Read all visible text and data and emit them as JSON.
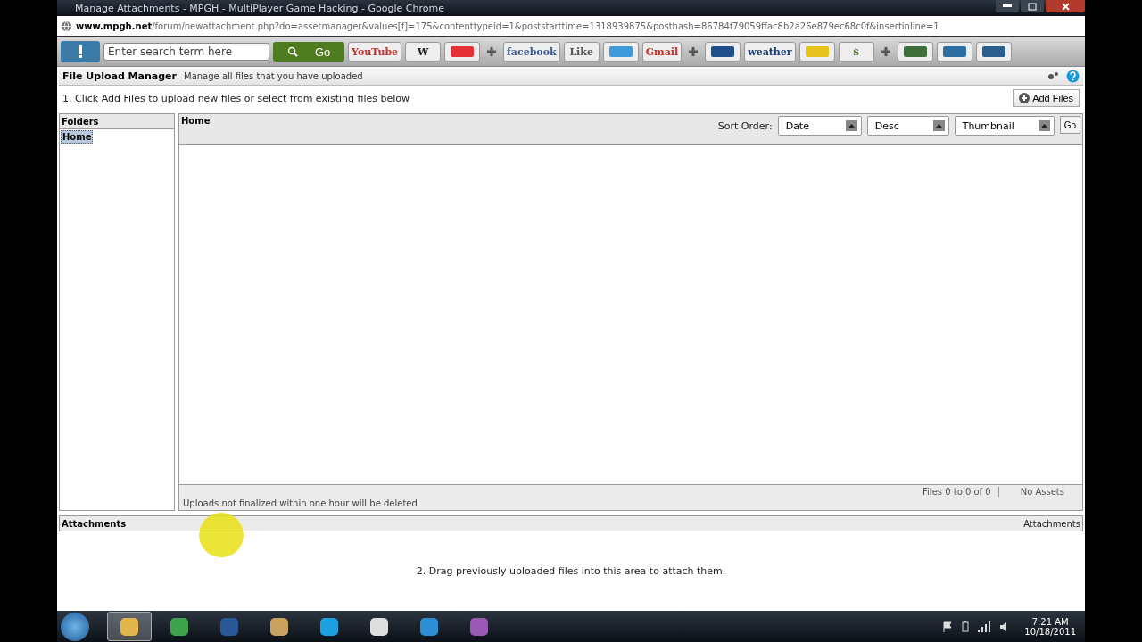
{
  "window": {
    "title": "Manage Attachments - MPGH - MultiPlayer Game Hacking - Google Chrome"
  },
  "address_bar": {
    "host": "www.mpgh.net",
    "path": "/forum/newattachment.php?do=assetmanager&values[f]=175&contenttypeid=1&poststarttime=1318939875&posthash=86784f79059ffac8b2a26e879ec68c0f&insertinline=1"
  },
  "toolbar": {
    "search": {
      "placeholder": "Enter search term here"
    },
    "go_button": "Go",
    "buttons": [
      {
        "kind": "text",
        "label": "YouTube",
        "color": "#c4302b"
      },
      {
        "kind": "text",
        "label": "W",
        "color": "#222222"
      },
      {
        "kind": "icon",
        "color": "#e53238"
      },
      {
        "kind": "plus"
      },
      {
        "kind": "text",
        "label": "facebook",
        "color": "#3b5998"
      },
      {
        "kind": "text",
        "label": "Like",
        "color": "#555555"
      },
      {
        "kind": "icon",
        "color": "#4099d8"
      },
      {
        "kind": "text",
        "label": "Gmail",
        "color": "#c4302b"
      },
      {
        "kind": "plus"
      },
      {
        "kind": "icon",
        "color": "#1f4f8a"
      },
      {
        "kind": "text",
        "label": "weather",
        "color": "#1c3f73"
      },
      {
        "kind": "icon",
        "color": "#e7c21b"
      },
      {
        "kind": "text",
        "label": "$",
        "color": "#4f7c1f"
      },
      {
        "kind": "plus"
      },
      {
        "kind": "icon",
        "color": "#3c6f3a"
      },
      {
        "kind": "icon",
        "color": "#2d6fa3"
      },
      {
        "kind": "icon",
        "color": "#2a5e8c"
      }
    ]
  },
  "manager": {
    "title": "File Upload Manager",
    "subtitle": "Manage all files that you have uploaded",
    "instruction": "1. Click Add Files to upload new files or select from existing files below",
    "add_button": "Add Files",
    "folders": {
      "heading": "Folders",
      "items": [
        {
          "label": "Home",
          "selected": true
        }
      ]
    },
    "files": {
      "heading": "Home",
      "sort_label": "Sort Order:",
      "selects": [
        "Date",
        "Desc",
        "Thumbnail"
      ],
      "go_button": "Go",
      "notice": "Uploads not finalized within one hour will be deleted",
      "range": "Files 0 to 0 of 0",
      "count": "No Assets"
    },
    "attachments": {
      "heading": "Attachments",
      "heading_right": "Attachments",
      "hint": "2. Drag previously uploaded files into this area to attach them."
    }
  },
  "taskbar": {
    "apps": [
      {
        "selected": true
      },
      {
        "selected": false
      },
      {
        "selected": false
      },
      {
        "selected": false
      },
      {
        "selected": false
      },
      {
        "selected": false
      },
      {
        "selected": false
      },
      {
        "selected": false
      }
    ],
    "time": "7:21 AM",
    "date": "10/18/2011"
  }
}
